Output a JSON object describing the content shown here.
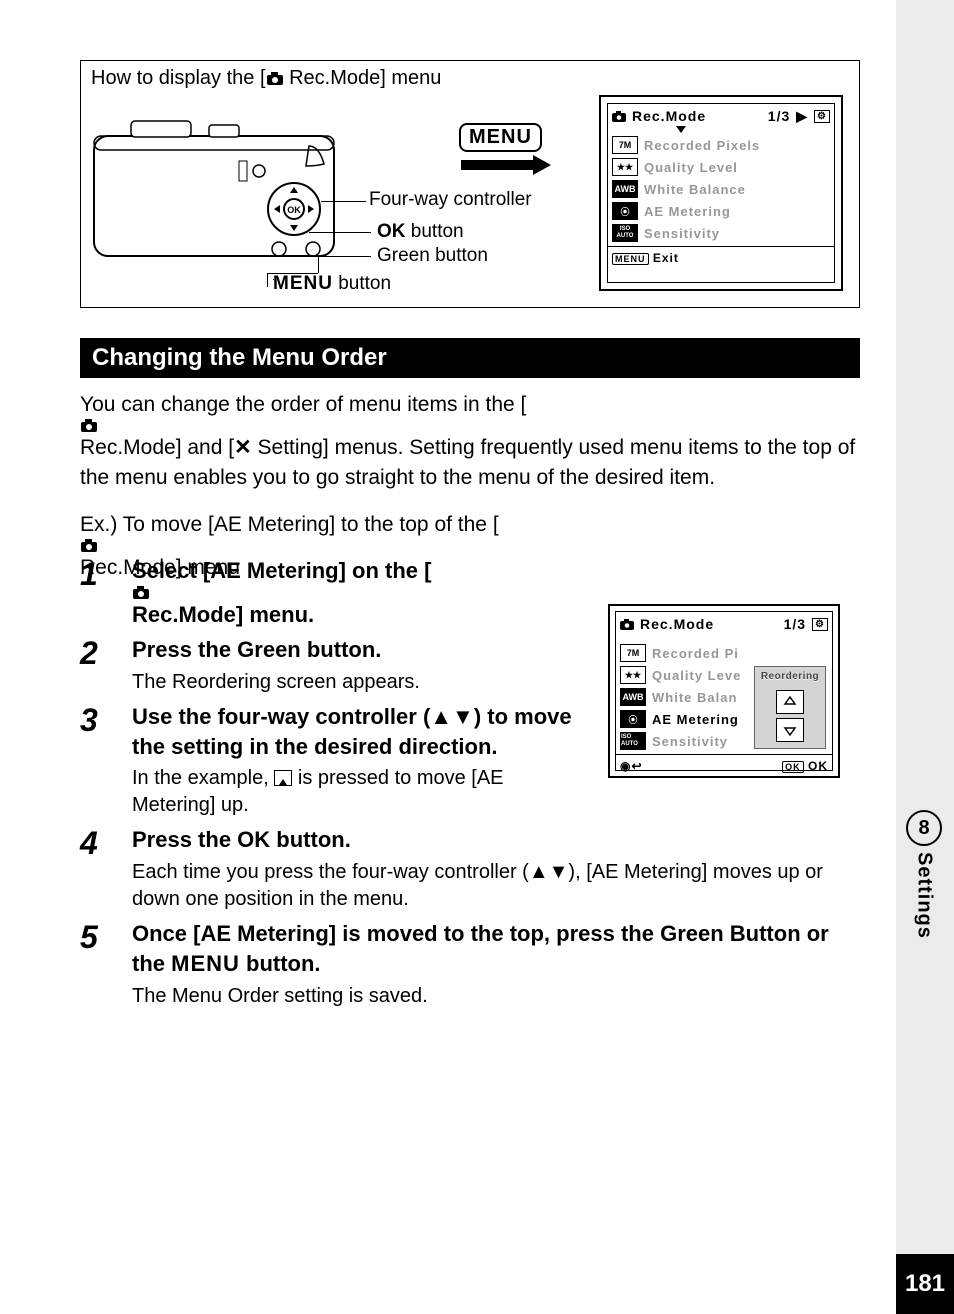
{
  "page_number": "181",
  "chapter": {
    "number": "8",
    "label": "Settings"
  },
  "howto": {
    "title_prefix": "How to display the [",
    "title_suffix": " Rec.Mode] menu",
    "menu_badge": "MENU",
    "labels": {
      "four_way": "Four-way controller",
      "ok_prefix": "OK",
      "ok_suffix": " button",
      "green": "Green button",
      "menu_prefix": "MENU",
      "menu_suffix": " button"
    }
  },
  "lcd1": {
    "title": "Rec.Mode",
    "page": "1/3",
    "items": [
      {
        "icon": "7M",
        "label": "Recorded Pixels"
      },
      {
        "icon": "★★",
        "label": "Quality Level"
      },
      {
        "icon": "AWB",
        "label": "White Balance"
      },
      {
        "icon": "⦿",
        "label": "AE Metering"
      },
      {
        "icon": "ISO AUTO",
        "label": "Sensitivity"
      }
    ],
    "footer_menu": "MENU",
    "footer_exit": "Exit"
  },
  "lcd2": {
    "title": "Rec.Mode",
    "page": "1/3",
    "items": [
      {
        "icon": "7M",
        "label": "Recorded Pi",
        "dimmed": true
      },
      {
        "icon": "★★",
        "label": "Quality Leve",
        "dimmed": true
      },
      {
        "icon": "AWB",
        "label": "White Balan",
        "dimmed": true
      },
      {
        "icon": "⦿",
        "label": "AE Metering",
        "dimmed": false
      },
      {
        "icon": "ISO AUTO",
        "label": "Sensitivity",
        "dimmed": true
      }
    ],
    "reorder_label": "Reordering",
    "footer_ok_label": "OK",
    "footer_ok_pill": "OK"
  },
  "heading": "Changing the Menu Order",
  "intro_p1a": "You can change the order of menu items in the [",
  "intro_p1b": " Rec.Mode] and [",
  "intro_p1c": " Setting] menus. Setting frequently used menu items to the top of the menu enables you to go straight to the menu of the desired item.",
  "example_line_a": "Ex.) To move [AE Metering] to the top of the [",
  "example_line_b": " Rec.Mode] menu",
  "steps": [
    {
      "num": "1",
      "head_a": "Select [AE Metering] on the [",
      "head_b": " Rec.Mode] menu."
    },
    {
      "num": "2",
      "head": "Press the Green button.",
      "note": "The Reordering screen appears."
    },
    {
      "num": "3",
      "head": "Use the four-way controller (▲▼) to move the setting in the desired direction.",
      "note_a": "In the example, ",
      "note_b": " is pressed to move [AE Metering] up."
    },
    {
      "num": "4",
      "head_a": "Press the ",
      "head_b": "OK",
      "head_c": " button.",
      "note": "Each time you press the four-way controller (▲▼), [AE Metering] moves up or down one position in the menu."
    },
    {
      "num": "5",
      "head_a": "Once [AE Metering] is moved to the top, press the Green Button or the ",
      "head_b": "MENU",
      "head_c": " button.",
      "note": "The Menu Order setting is saved."
    }
  ]
}
